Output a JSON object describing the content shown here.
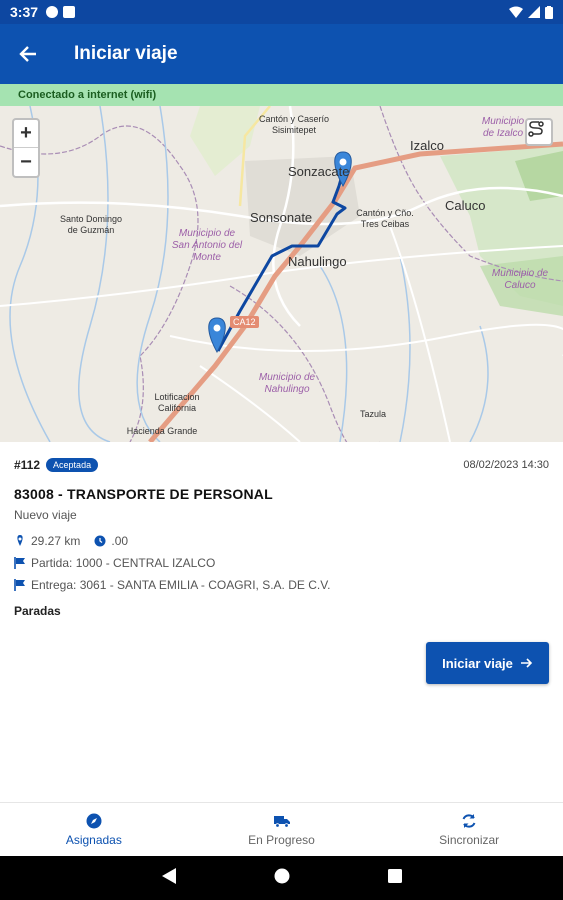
{
  "status_bar": {
    "time": "3:37"
  },
  "app_bar": {
    "title": "Iniciar viaje"
  },
  "connection_banner": "Conectado a internet (wifi)",
  "map": {
    "labels": {
      "canton_casemo": "Cantón y Caserío Sisimitepet",
      "sonzacate": "Sonzacate",
      "izalco": "Izalco",
      "municipio_izalco": "Municipio de Izalco",
      "caluco": "Caluco",
      "sonsonate": "Sonsonate",
      "canton_tres_ceibas": "Cantón y Cño. Tres Ceibas",
      "santo_domingo": "Santo Domingo de Guzmán",
      "municipio_san_antonio": "Municipio de San Antonio del Monte",
      "nahulingo": "Nahulingo",
      "municipio_caluco": "Municipio de Caluco",
      "municipio_nahulingo": "Municipio de Nahulingo",
      "lotificacion": "Lotificacion California",
      "hacienda_grande": "Hacienda Grande",
      "tazula": "Tazula",
      "road_shield": "CA12"
    },
    "zoom_in": "+",
    "zoom_out": "−"
  },
  "trip": {
    "number": "#112",
    "status": "Aceptada",
    "datetime": "08/02/2023 14:30",
    "name": "83008 - TRANSPORTE DE PERSONAL",
    "subtitle": "Nuevo viaje",
    "distance": "29.27 km",
    "duration": ".00",
    "origin": "Partida: 1000 - CENTRAL IZALCO",
    "destination": "Entrega: 3061 - SANTA EMILIA - COAGRI, S.A. DE C.V.",
    "stops_label": "Paradas"
  },
  "start_button": "Iniciar viaje",
  "bottom_nav": [
    {
      "label": "Asignadas",
      "icon": "compass-icon"
    },
    {
      "label": "En Progreso",
      "icon": "truck-icon"
    },
    {
      "label": "Sincronizar",
      "icon": "sync-icon"
    }
  ],
  "colors": {
    "primary": "#0d52b0",
    "banner": "#a5e3b1",
    "route": "#0d47a1",
    "pin": "#3a86d9"
  }
}
